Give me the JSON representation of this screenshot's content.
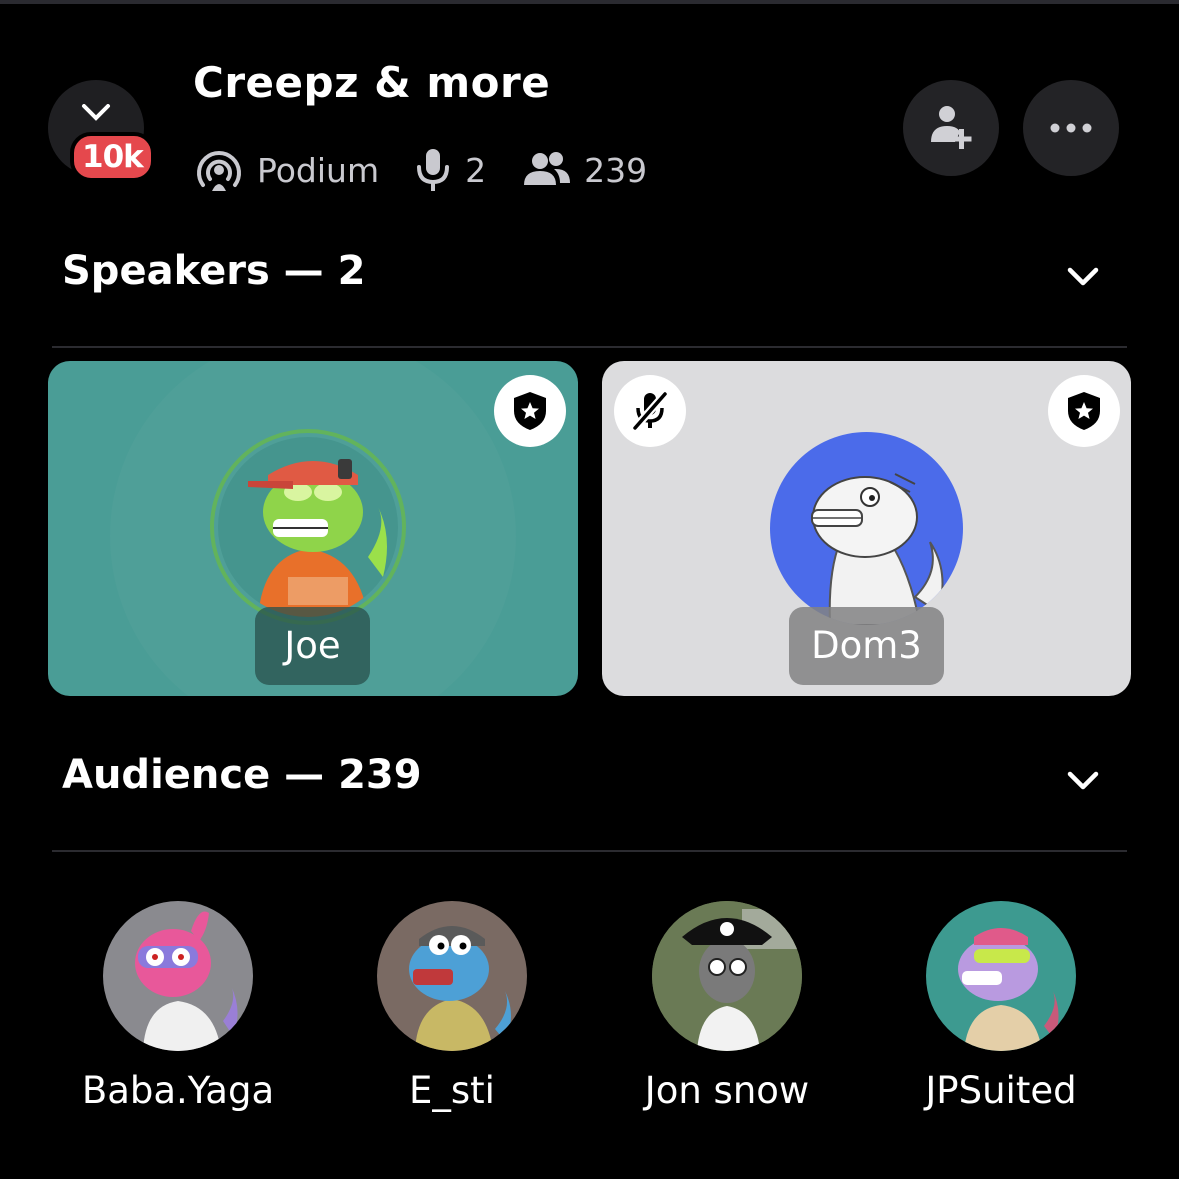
{
  "header": {
    "server_badge": "10k",
    "title": "Creepz & more",
    "channel_type": "Podium",
    "speaker_count": "2",
    "listener_count": "239",
    "invite_button_icon": "add-user-icon",
    "more_button_icon": "more-dots-icon"
  },
  "speakers": {
    "heading": "Speakers — 2",
    "items": [
      {
        "name": "Joe",
        "moderator": true,
        "muted": false,
        "card_color": "#4a9d96"
      },
      {
        "name": "Dom3",
        "moderator": true,
        "muted": true,
        "card_color": "#dcdcde",
        "avatar_color": "#4b6bea"
      }
    ]
  },
  "audience": {
    "heading": "Audience — 239",
    "items": [
      {
        "name": "Baba.Yaga",
        "avatar_color": "#8a8a8f"
      },
      {
        "name": "E_sti",
        "avatar_color": "#7a6a63"
      },
      {
        "name": "Jon snow",
        "avatar_color": "#5f6f4a"
      },
      {
        "name": "JPSuited",
        "avatar_color": "#3d9a90"
      }
    ]
  },
  "colors": {
    "background": "#000000",
    "live_badge": "#e5484d",
    "speaking_ring": "#62b35c"
  }
}
